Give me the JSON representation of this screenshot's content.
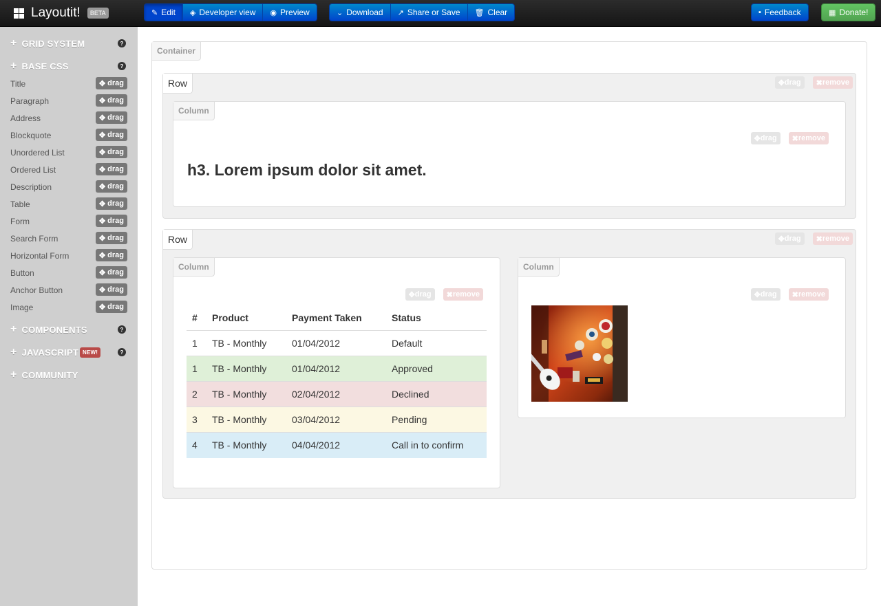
{
  "brand": {
    "name": "Layoutit!",
    "badge": "BETA"
  },
  "toolbar": {
    "edit": "Edit",
    "developer_view": "Developer view",
    "preview": "Preview",
    "download": "Download",
    "share_or_save": "Share or Save",
    "clear": "Clear",
    "feedback": "Feedback",
    "donate": "Donate!"
  },
  "sidebar": {
    "grid_system": "GRID SYSTEM",
    "base_css": "BASE CSS",
    "components": "COMPONENTS",
    "javascript": "JAVASCRIPT",
    "javascript_badge": "NEW!",
    "community": "COMMUNITY",
    "help_glyph": "?",
    "drag_label": "drag",
    "items": [
      "Title",
      "Paragraph",
      "Address",
      "Blockquote",
      "Unordered List",
      "Ordered List",
      "Description",
      "Table",
      "Form",
      "Search Form",
      "Horizontal Form",
      "Button",
      "Anchor Button",
      "Image"
    ]
  },
  "canvas": {
    "container_label": "Container",
    "row_label": "Row",
    "column_label": "Column",
    "drag_label": "drag",
    "remove_label": "remove",
    "heading": "h3. Lorem ipsum dolor sit amet.",
    "table": {
      "headers": [
        "#",
        "Product",
        "Payment Taken",
        "Status"
      ],
      "rows": [
        {
          "style": "default",
          "cells": [
            "1",
            "TB - Monthly",
            "01/04/2012",
            "Default"
          ]
        },
        {
          "style": "success",
          "cells": [
            "1",
            "TB - Monthly",
            "01/04/2012",
            "Approved"
          ]
        },
        {
          "style": "error",
          "cells": [
            "2",
            "TB - Monthly",
            "02/04/2012",
            "Declined"
          ]
        },
        {
          "style": "warning",
          "cells": [
            "3",
            "TB - Monthly",
            "03/04/2012",
            "Pending"
          ]
        },
        {
          "style": "info",
          "cells": [
            "4",
            "TB - Monthly",
            "04/04/2012",
            "Call in to confirm"
          ]
        }
      ]
    }
  },
  "colors": {
    "primary": "#0044cc",
    "success": "#51a351",
    "sidebar_bg": "#cfcfcf",
    "row_success": "#dff0d8",
    "row_error": "#f2dede",
    "row_warning": "#fcf8e3",
    "row_info": "#d9edf7"
  }
}
